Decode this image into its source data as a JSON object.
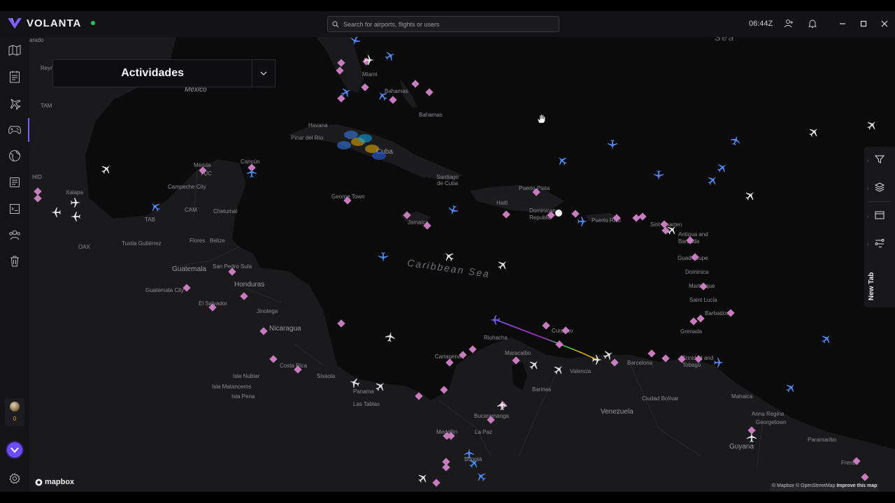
{
  "app": {
    "name": "VOLANTA",
    "status_color": "#22c55e",
    "accent_color": "#7c5cff"
  },
  "topbar": {
    "search_placeholder": "Search for airports, flights or users",
    "clock": "06:44Z",
    "icons": [
      "search-icon",
      "friends-icon",
      "bell-icon",
      "minimize-icon",
      "maximize-icon",
      "close-icon"
    ]
  },
  "sidebar": {
    "items": [
      {
        "name": "map",
        "icon": "map-icon"
      },
      {
        "name": "logbook",
        "icon": "logbook-icon"
      },
      {
        "name": "flight-planning",
        "icon": "plane-route-icon"
      },
      {
        "name": "simulator",
        "icon": "gamepad-icon",
        "active": true
      },
      {
        "name": "explore",
        "icon": "globe-icon"
      },
      {
        "name": "reports",
        "icon": "document-icon"
      },
      {
        "name": "code",
        "icon": "code-icon"
      },
      {
        "name": "community",
        "icon": "users-icon"
      },
      {
        "name": "trash",
        "icon": "trash-icon"
      }
    ],
    "user_count": "0",
    "settings_icon": "gear-icon"
  },
  "activity_panel": {
    "title": "Actividades"
  },
  "right_panel": {
    "items": [
      "filter-icon",
      "layers-icon",
      "window-icon",
      "route-settings-icon"
    ],
    "new_tab_label": "New Tab"
  },
  "map": {
    "labels": {
      "sea": "Sea",
      "caribbean_sea": "Caribbean Sea",
      "mexico": "Mexico",
      "bahamas": "Bahamas",
      "bahamas2": "Bahamas",
      "havana": "Havana",
      "pinar_del_rio": "Pinar del Río",
      "cuba": "Cuba",
      "miami": "Miami",
      "santiago": "Santiago de Cuba",
      "puerto_plata": "Puerto Plata",
      "haiti": "Haiti",
      "dominican": "Dominican Republic",
      "jamaica": "Jamaica",
      "georgetown_cay": "George Town",
      "puerto_rico": "Puerto Rico",
      "sint_maarten": "Sint Maarten",
      "antigua": "Antigua and Barbuda",
      "guadeloupe": "Guadeloupe",
      "dominica": "Dominica",
      "martinique": "Martinique",
      "saint_lucia": "Saint Lucia",
      "barbados": "Barbados",
      "grenada": "Grenada",
      "trinidad": "Trinidad and Tobago",
      "merida": "Mérida",
      "cancun": "Cancún",
      "campeche": "Campeche City",
      "chetumal": "Chetumal",
      "belize": "Belize",
      "flores": "Flores",
      "xalapa": "Xalapa",
      "tuxtla": "Tuxtla Gutiérrez",
      "guatemala": "Guatemala",
      "guatemala_city": "Guatemala City",
      "san_pedro": "San Pedro Sula",
      "honduras": "Honduras",
      "el_salvador": "El Salvador",
      "jinotega": "Jinotega",
      "nicaragua": "Nicaragua",
      "costa_rica": "Costa Rica",
      "isla_nublar": "Isla Nublar",
      "isla_matanceros": "Isla Matanceros",
      "isla_pena": "Isla Pena",
      "sixaola": "Sixaola",
      "panama": "Panama",
      "las_tablas": "Las Tablas",
      "cartagena": "Cartagena",
      "riohacha": "Riohacha",
      "maracaibo": "Maracaibo",
      "curacao": "Curaçao",
      "valencia": "Valencia",
      "barcelona": "Barcelona",
      "barinas": "Barinas",
      "ciudad_bolivar": "Ciudad Bolívar",
      "venezuela": "Venezuela",
      "bucaramanga": "Bucaramanga",
      "medellin": "Medellín",
      "la_paz": "La Paz",
      "bogota": "Bogotá",
      "mahaica": "Mahaica",
      "anna_regina": "Anna Regina",
      "georgetown": "Georgetown",
      "guyana": "Guyana",
      "paramaribo": "Paramaribo",
      "french": "French",
      "merida_tam": "TAM",
      "reynosa": "Reyn",
      "guadalajara": "arado",
      "yuc": "YUC",
      "oax": "OAX",
      "tab": "TAB",
      "cam": "CAM",
      "hid": "HID"
    },
    "flight_path_colors": [
      "#7c5cff",
      "#c026d3",
      "#22c55e",
      "#eab308"
    ],
    "marker_color": "#c77dbd",
    "attribution": "© Mapbox © OpenStreetMap",
    "attribution_link": "Improve this map",
    "logo": "mapbox"
  }
}
